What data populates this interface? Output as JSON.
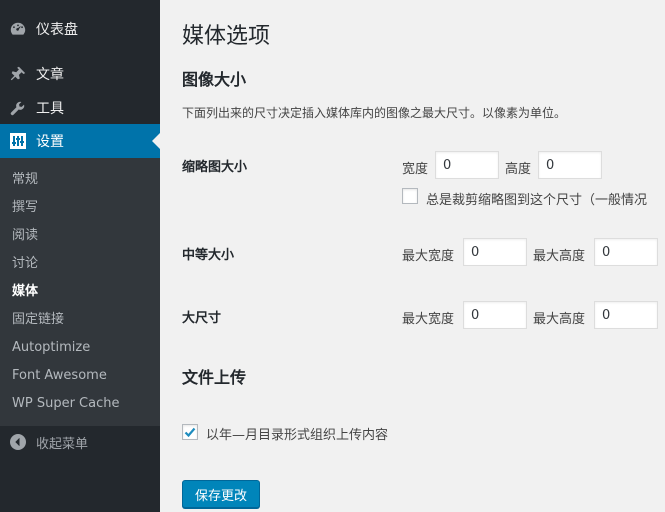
{
  "sidebar": {
    "dashboard": "仪表盘",
    "posts": "文章",
    "tools": "工具",
    "settings": "设置",
    "submenu": [
      "常规",
      "撰写",
      "阅读",
      "讨论",
      "媒体",
      "固定链接",
      "Autoptimize",
      "Font Awesome",
      "WP Super Cache"
    ],
    "current_submenu": "媒体",
    "collapse": "收起菜单"
  },
  "page": {
    "title": "媒体选项",
    "image_sizes_heading": "图像大小",
    "image_sizes_desc": "下面列出来的尺寸决定插入媒体库内的图像之最大尺寸。以像素为单位。",
    "thumbnail": {
      "label": "缩略图大小",
      "width_label": "宽度",
      "width": "0",
      "height_label": "高度",
      "height": "0",
      "crop_label": "总是裁剪缩略图到这个尺寸（一般情况",
      "crop_checked": false
    },
    "medium": {
      "label": "中等大小",
      "width_label": "最大宽度",
      "width": "0",
      "height_label": "最大高度",
      "height": "0"
    },
    "large": {
      "label": "大尺寸",
      "width_label": "最大宽度",
      "width": "0",
      "height_label": "最大高度",
      "height": "0"
    },
    "uploads_heading": "文件上传",
    "uploads_checkbox_label": "以年—月目录形式组织上传内容",
    "uploads_checked": true,
    "save_button": "保存更改"
  },
  "colors": {
    "accent": "#0073aa",
    "button": "#0085ba",
    "sidebar_bg": "#23282d",
    "submenu_bg": "#32373c"
  }
}
